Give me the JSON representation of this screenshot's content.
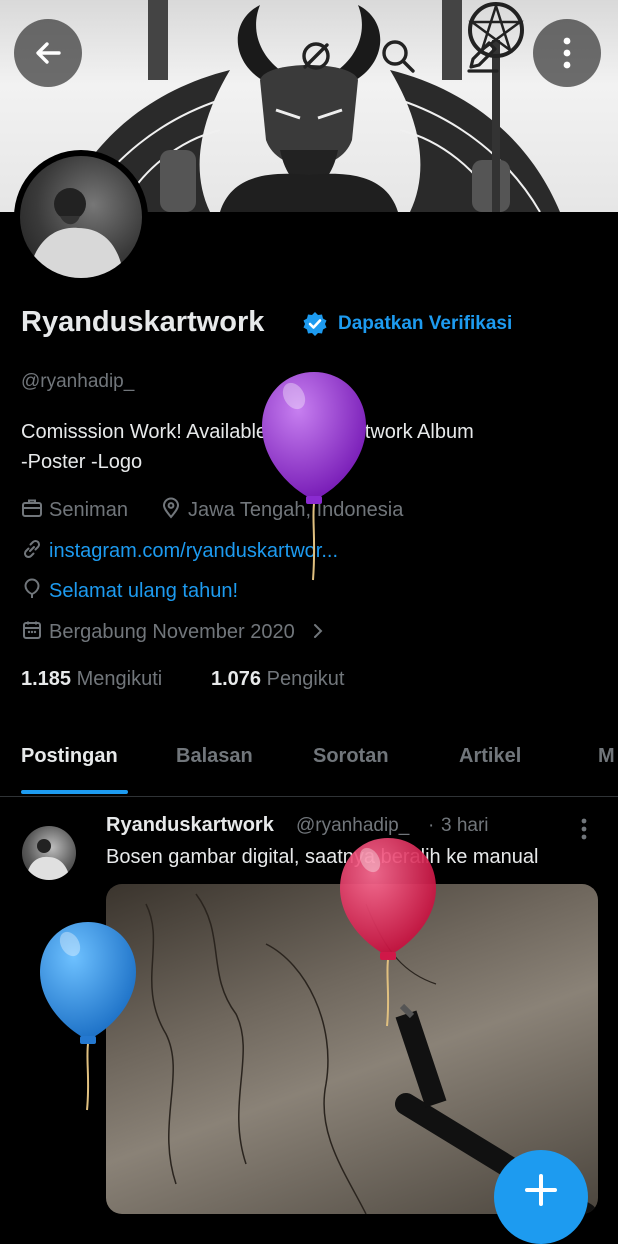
{
  "header": {
    "back_icon": "arrow-left-icon",
    "grok_icon": "grok-slash-icon",
    "search_icon": "search-icon",
    "edit_icon": "pencil-icon",
    "more_icon": "more-vertical-icon"
  },
  "profile": {
    "display_name": "Ryanduskartwork",
    "verified_badge": "verified-badge-icon",
    "get_verified_label": "Dapatkan Verifikasi",
    "handle": "@ryanhadip_",
    "bio_line1": "Comisssion Work!  Available: -Tshirt -Artwork Album",
    "bio_line2": "-Poster -Logo",
    "profession": "Seniman",
    "location": "Jawa Tengah, Indonesia",
    "website": "instagram.com/ryanduskartwor...",
    "birthday_text": "Selamat ulang tahun!",
    "joined": "Bergabung November 2020",
    "following_count": "1.185",
    "following_label": "Mengikuti",
    "followers_count": "1.076",
    "followers_label": "Pengikut"
  },
  "tabs": [
    {
      "label": "Postingan",
      "active": true
    },
    {
      "label": "Balasan",
      "active": false
    },
    {
      "label": "Sorotan",
      "active": false
    },
    {
      "label": "Artikel",
      "active": false
    },
    {
      "label": "M",
      "active": false
    }
  ],
  "post": {
    "author_name": "Ryanduskartwork",
    "author_handle": "@ryanhadip_",
    "separator": "·",
    "time": "3 hari",
    "text": "Bosen gambar digital, saatnya beralih ke manual"
  },
  "balloons": [
    {
      "color": "purple"
    },
    {
      "color": "red"
    },
    {
      "color": "blue"
    }
  ],
  "colors": {
    "accent": "#1d9bf0",
    "background": "#000000",
    "text_primary": "#e7e9ea",
    "text_secondary": "#71767b"
  }
}
